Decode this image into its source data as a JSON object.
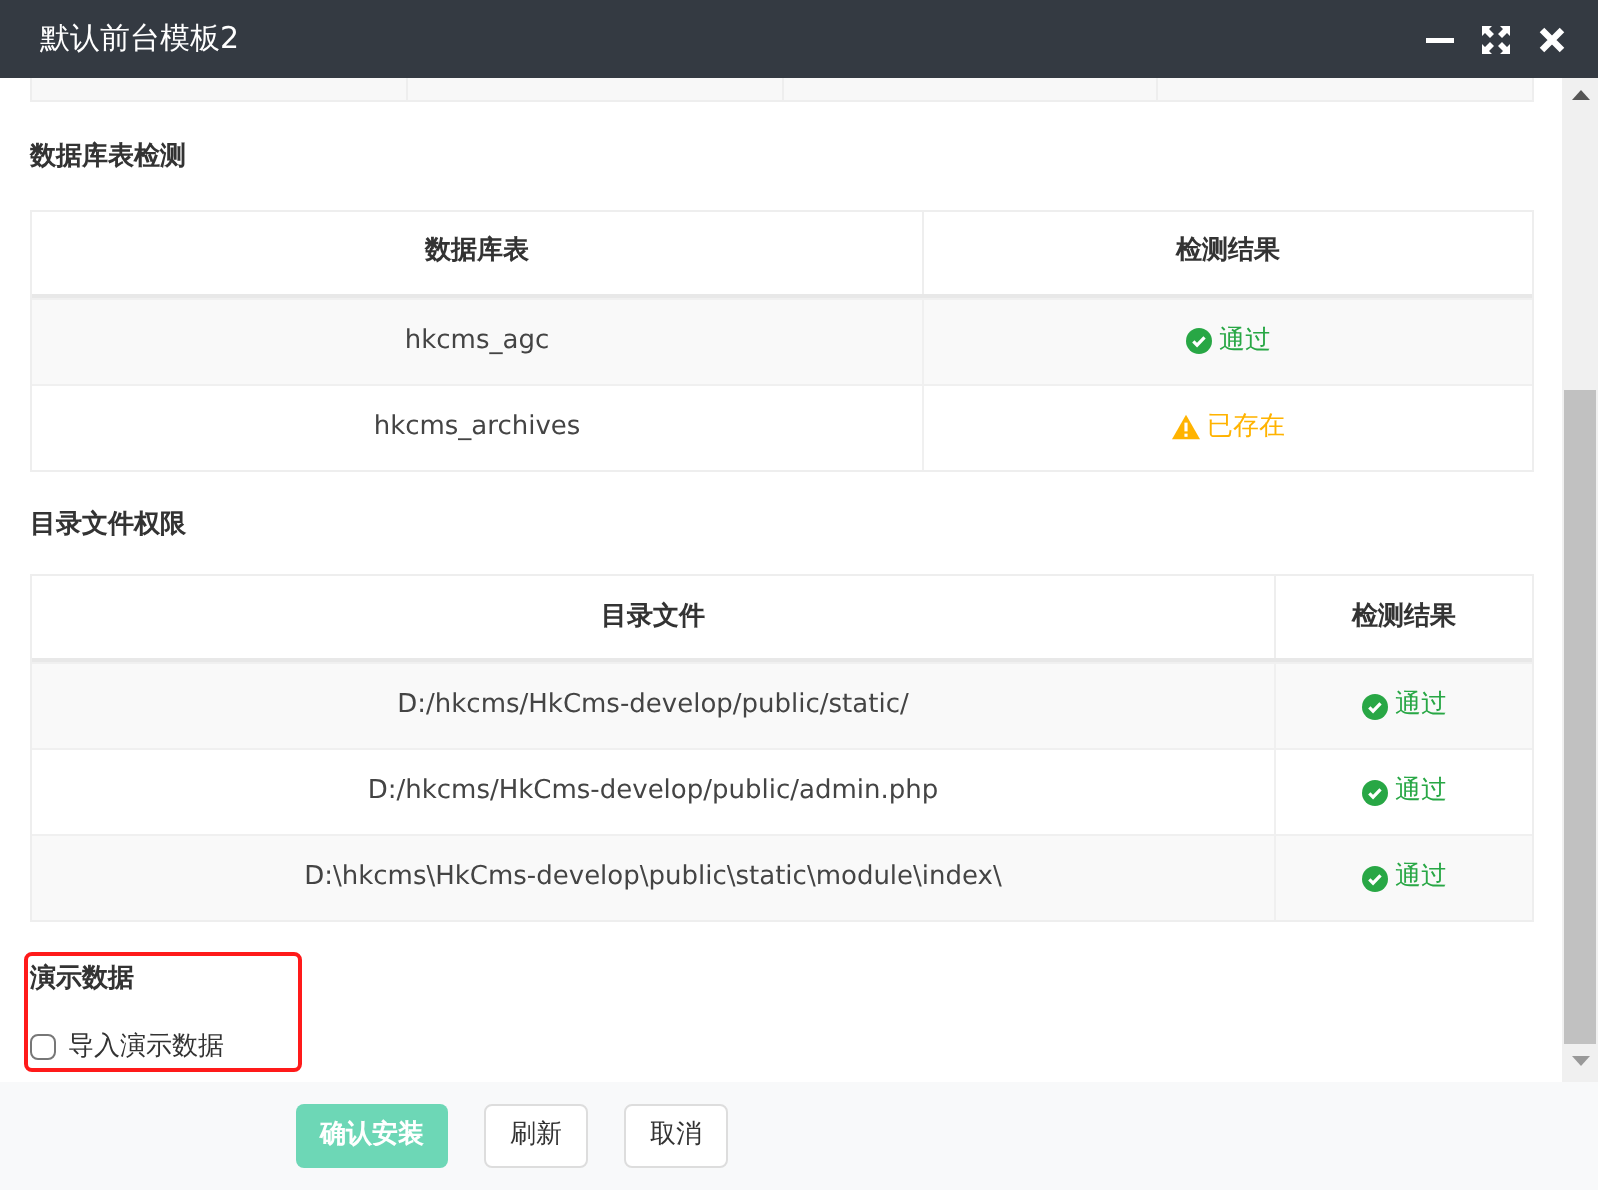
{
  "window": {
    "title": "默认前台模板2"
  },
  "db_check": {
    "heading": "数据库表检测",
    "columns": [
      "数据库表",
      "检测结果"
    ],
    "rows": [
      {
        "name": "hkcms_agc",
        "result": {
          "kind": "pass",
          "text": "通过"
        }
      },
      {
        "name": "hkcms_archives",
        "result": {
          "kind": "warning",
          "text": "已存在"
        }
      }
    ]
  },
  "dir_check": {
    "heading": "目录文件权限",
    "columns": [
      "目录文件",
      "检测结果"
    ],
    "rows": [
      {
        "name": "D:/hkcms/HkCms-develop/public/static/",
        "result": {
          "kind": "pass",
          "text": "通过"
        }
      },
      {
        "name": "D:/hkcms/HkCms-develop/public/admin.php",
        "result": {
          "kind": "pass",
          "text": "通过"
        }
      },
      {
        "name": "D:\\hkcms\\HkCms-develop\\public\\static\\module\\index\\",
        "result": {
          "kind": "pass",
          "text": "通过"
        }
      }
    ]
  },
  "demo": {
    "heading": "演示数据",
    "checkbox": {
      "label": "导入演示数据",
      "checked": false
    }
  },
  "buttons": [
    {
      "label": "确认安装",
      "kind": "primary",
      "disabled": true
    },
    {
      "label": "刷新",
      "kind": "default",
      "disabled": false
    },
    {
      "label": "取消",
      "kind": "default",
      "disabled": false
    }
  ]
}
